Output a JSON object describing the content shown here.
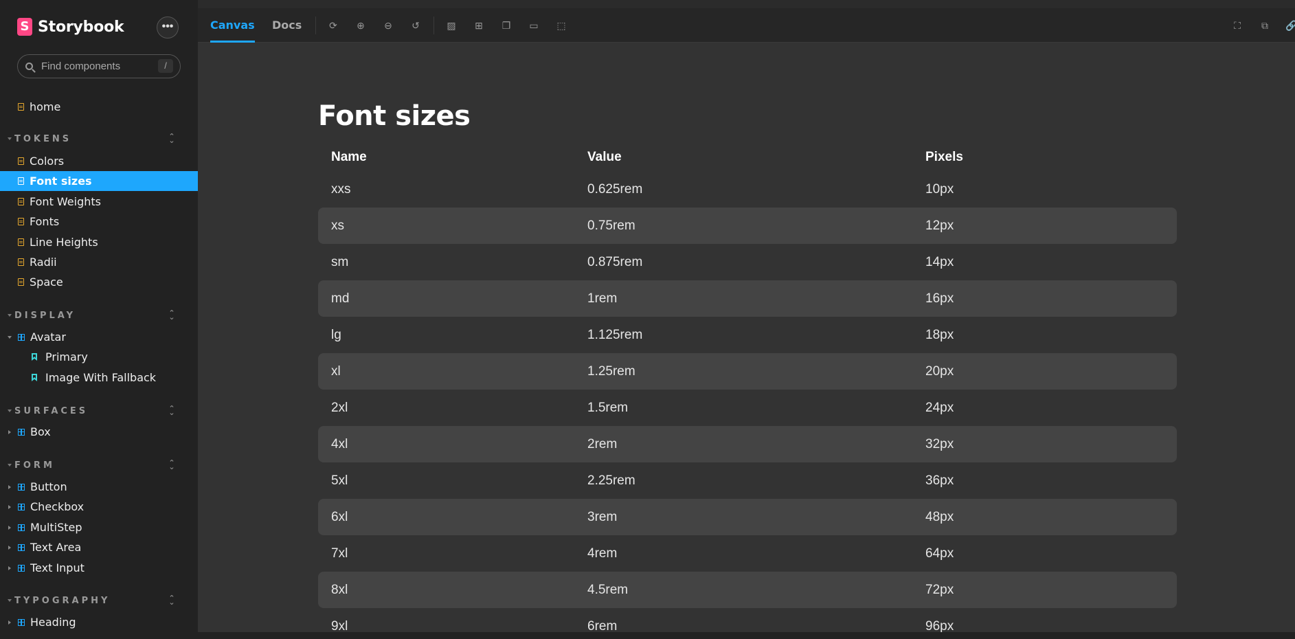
{
  "brand": {
    "name": "Storybook",
    "logo_letter": "S"
  },
  "search": {
    "placeholder": "Find components",
    "shortcut": "/"
  },
  "sidebar": {
    "home": "home",
    "tokens": {
      "title": "TOKENS",
      "items": [
        "Colors",
        "Font sizes",
        "Font Weights",
        "Fonts",
        "Line Heights",
        "Radii",
        "Space"
      ],
      "active": "Font sizes"
    },
    "display": {
      "title": "DISPLAY",
      "component": "Avatar",
      "stories": [
        "Primary",
        "Image With Fallback"
      ]
    },
    "surfaces": {
      "title": "SURFACES",
      "items": [
        "Box"
      ]
    },
    "form": {
      "title": "FORM",
      "items": [
        "Button",
        "Checkbox",
        "MultiStep",
        "Text Area",
        "Text Input"
      ]
    },
    "typography": {
      "title": "TYPOGRAPHY",
      "items": [
        "Heading"
      ]
    }
  },
  "toolbar": {
    "tabs": [
      "Canvas",
      "Docs"
    ],
    "active_tab": "Canvas",
    "tools": [
      "refresh-icon",
      "zoom-in-icon",
      "zoom-out-icon",
      "zoom-reset-icon",
      "background-icon",
      "grid-icon",
      "viewport-icon",
      "measure-icon",
      "outline-icon"
    ],
    "right_tools": [
      "fullscreen-icon",
      "open-new-tab-icon",
      "copy-link-icon"
    ]
  },
  "main": {
    "title": "Font sizes",
    "columns": [
      "Name",
      "Value",
      "Pixels"
    ],
    "rows": [
      [
        "xxs",
        "0.625rem",
        "10px"
      ],
      [
        "xs",
        "0.75rem",
        "12px"
      ],
      [
        "sm",
        "0.875rem",
        "14px"
      ],
      [
        "md",
        "1rem",
        "16px"
      ],
      [
        "lg",
        "1.125rem",
        "18px"
      ],
      [
        "xl",
        "1.25rem",
        "20px"
      ],
      [
        "2xl",
        "1.5rem",
        "24px"
      ],
      [
        "4xl",
        "2rem",
        "32px"
      ],
      [
        "5xl",
        "2.25rem",
        "36px"
      ],
      [
        "6xl",
        "3rem",
        "48px"
      ],
      [
        "7xl",
        "4rem",
        "64px"
      ],
      [
        "8xl",
        "4.5rem",
        "72px"
      ],
      [
        "9xl",
        "6rem",
        "96px"
      ]
    ]
  },
  "colors": {
    "accent": "#1ea7fd",
    "logo": "#ff4785",
    "doc_icon": "#e8a92e",
    "story_icon": "#3dd5d8"
  }
}
